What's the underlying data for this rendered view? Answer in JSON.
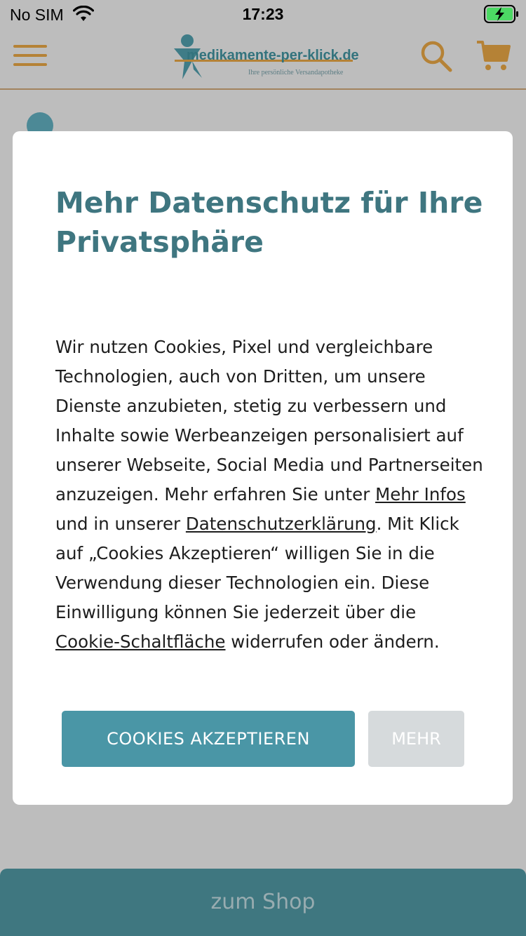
{
  "status_bar": {
    "carrier": "No SIM",
    "time": "17:23",
    "wifi_icon": "wifi-icon",
    "battery_icon": "battery-charging-icon"
  },
  "header": {
    "menu_icon": "hamburger-menu-icon",
    "logo_name": "medikamente-per-klick.de",
    "logo_tagline": "Ihre persönliche Versandapotheke",
    "search_icon": "search-icon",
    "cart_icon": "cart-icon",
    "accent_color": "#b58236"
  },
  "consent_modal": {
    "title": "Mehr Datenschutz für Ihre Privatsphäre",
    "body": {
      "part1": "Wir nutzen Cookies, Pixel und vergleichbare Technologien, auch von Dritten, um unsere Dienste anzubieten, stetig zu verbessern und Inhalte sowie Werbeanzeigen personalisiert auf unserer Webseite, Social Media und Partnerseiten anzuzeigen. Mehr erfahren Sie unter ",
      "link_more_info": "Mehr Infos",
      "part2": " und in unserer ",
      "link_privacy": "Datenschutzerklärung",
      "part3": ". Mit Klick auf „Cookies Akzeptieren“ willigen Sie in die Verwendung dieser Technologien ein. Diese Einwilligung können Sie jederzeit über die ",
      "link_cookie_button": "Cookie-Schaltfläche",
      "part4": " widerrufen oder ändern."
    },
    "accept_button": "COOKIES AKZEPTIEREN",
    "more_button": "MEHR",
    "title_color": "#3f7680",
    "accept_color": "#4a96a6"
  },
  "bottom_bar": {
    "shop_button": "zum Shop",
    "color": "#3f7780"
  }
}
